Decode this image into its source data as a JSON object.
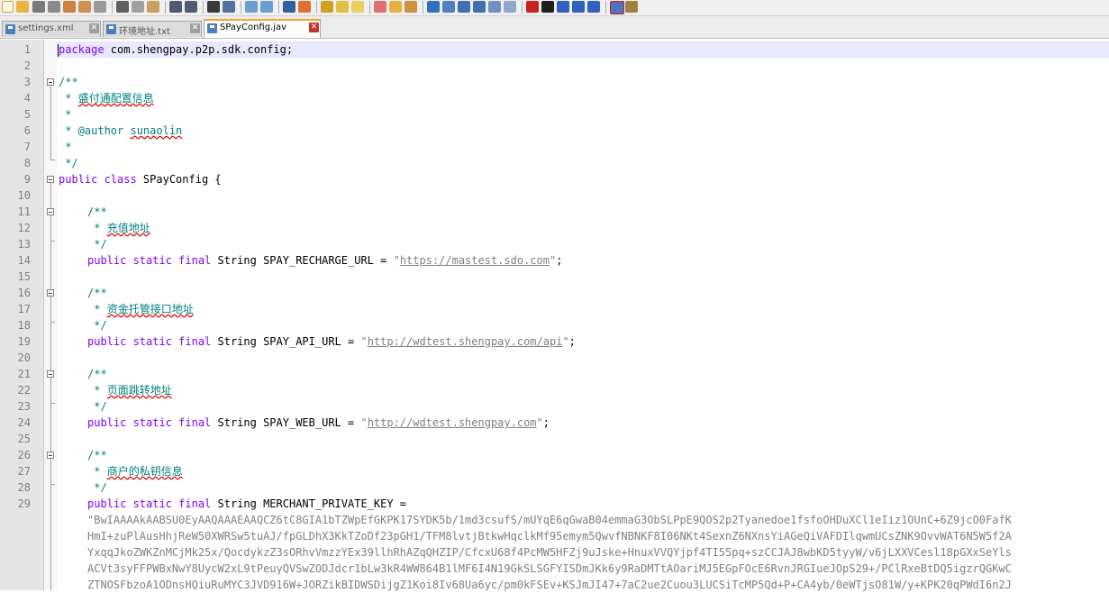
{
  "tabs": [
    {
      "label": "settings.xml",
      "active": false
    },
    {
      "label": "环境地址.txt",
      "active": false
    },
    {
      "label": "SPayConfig.jav",
      "active": true
    }
  ],
  "line_numbers": [
    "1",
    "2",
    "3",
    "4",
    "5",
    "6",
    "7",
    "8",
    "9",
    "10",
    "11",
    "12",
    "13",
    "14",
    "15",
    "16",
    "17",
    "18",
    "19",
    "20",
    "21",
    "22",
    "23",
    "24",
    "25",
    "26",
    "27",
    "28",
    "29"
  ],
  "code": {
    "l1_kw": "package",
    "l1_rest": " com.shengpay.p2p.sdk.config;",
    "l3": "/**",
    "l4_star": " * ",
    "l4_text": "盛付通配置信息",
    "l5": " *",
    "l6_pre": " * @author ",
    "l6_name": "sunaolin",
    "l7": " *",
    "l8": " */",
    "l9_kw": "public class",
    "l9_rest": " SPayConfig {",
    "c_open": "/**",
    "c_star": " * ",
    "c_close": " */",
    "l12_text": "充值地址",
    "l14_kw": "public static final",
    "l14_mid": " String SPAY_RECHARGE_URL = ",
    "l14_url": "https://mastest.sdo.com",
    "l17_text": "资金托管接口地址",
    "l19_mid": " String SPAY_API_URL = ",
    "l19_url": "http://wdtest.shengpay.com/api",
    "l22_text": "页面跳转地址",
    "l24_mid": " String SPAY_WEB_URL = ",
    "l24_url": "http://wdtest.shengpay.com",
    "l27_text": "商户的私钥信息",
    "l29_mid": " String MERCHANT_PRIVATE_KEY =",
    "key_lines": [
      "\"BwIAAAAkAABSU0EyAAQAAAEAAQCZ6tC8GIA1bTZWpEfGKPK17SYDK5b/1md3csufS/mUYqE6qGwaB04emmaG3ObSLPpE9QOS2p2Tyanedoe1fsfoOHDuXCl1eIiz1OUnC+6Z9jcO0FafK",
      "HmI+zuPlAusHhjReW50XWRSw5tuAJ/fpGLDhX3KkTZoDf23pGH1/TFM8lvtjBtkwHqclkMf95emym5QwvfNBNKF8I06NKt4SexnZ6NXnsYiAGeQiVAFDIlqwmUCsZNK9OvvWAT6N5W5f2A",
      "YxqqJkoZWKZnMCjMk25x/QocdykzZ3sORhvVmzzYEx39llhRhAZqQHZIP/CfcxU68f4PcMW5HFZj9uJske+HnuxVVQYjpf4TI55pq+szCCJAJ8wbKD5tyyW/v6jLXXVCesl18pGXxSeYls",
      "ACVt3syFFPWBxNwY8UycW2xL9tPeuyQVSwZODJdcr1bLw3kR4WW864B1lMF6I4N19GkSLSGFYISDmJKk6y9RaDMTtAOariMJ5EGpFOcE6RvnJRGIueJOpS29+/PClRxeBtDQ5igzrQGKwC",
      "ZTNOSFbzoA1ODnsHQiuRuMYC3JVD916W+JORZikBIDWSDijgZ1Koi8Iv68Ua6yc/pm0kFSEv+KSJmJI47+7aC2ue2Cuou3LUCSiTcMP5Qd+P+CA4yb/0eWTjsO81W/y+KPK20qPWdI6n2J"
    ]
  }
}
